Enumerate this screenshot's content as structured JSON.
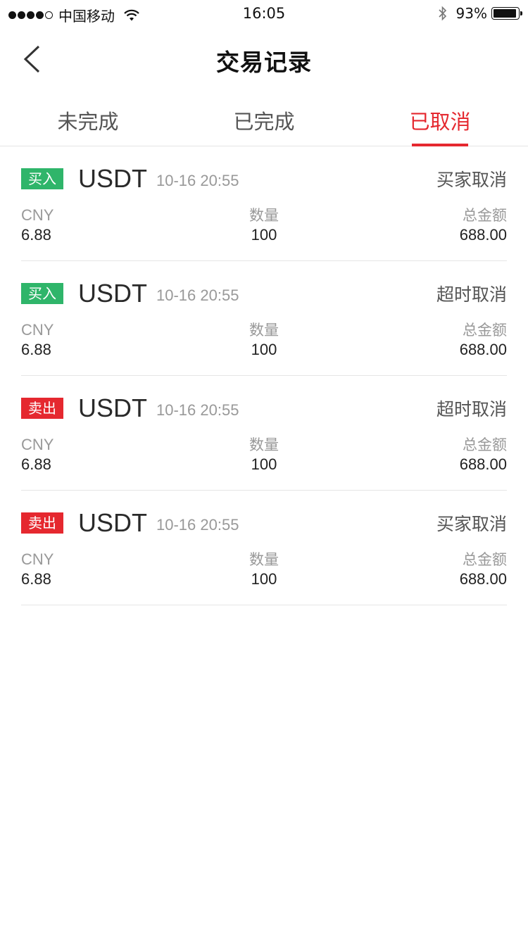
{
  "status_bar": {
    "carrier": "中国移动",
    "time": "16:05",
    "battery": "93%",
    "battery_level": 0.93
  },
  "nav": {
    "title": "交易记录"
  },
  "tabs": [
    {
      "label": "未完成",
      "active": false
    },
    {
      "label": "已完成",
      "active": false
    },
    {
      "label": "已取消",
      "active": true
    }
  ],
  "colors": {
    "accent_red": "#e5282f",
    "buy_green": "#2fb56a"
  },
  "orders": [
    {
      "side": "买入",
      "side_type": "buy",
      "coin": "USDT",
      "time": "10-16 20:55",
      "status": "买家取消",
      "price_label": "CNY",
      "price": "6.88",
      "qty_label": "数量",
      "qty": "100",
      "total_label": "总金额",
      "total": "688.00"
    },
    {
      "side": "买入",
      "side_type": "buy",
      "coin": "USDT",
      "time": "10-16 20:55",
      "status": "超时取消",
      "price_label": "CNY",
      "price": "6.88",
      "qty_label": "数量",
      "qty": "100",
      "total_label": "总金额",
      "total": "688.00"
    },
    {
      "side": "卖出",
      "side_type": "sell",
      "coin": "USDT",
      "time": "10-16 20:55",
      "status": "超时取消",
      "price_label": "CNY",
      "price": "6.88",
      "qty_label": "数量",
      "qty": "100",
      "total_label": "总金额",
      "total": "688.00"
    },
    {
      "side": "卖出",
      "side_type": "sell",
      "coin": "USDT",
      "time": "10-16 20:55",
      "status": "买家取消",
      "price_label": "CNY",
      "price": "6.88",
      "qty_label": "数量",
      "qty": "100",
      "total_label": "总金额",
      "total": "688.00"
    }
  ]
}
